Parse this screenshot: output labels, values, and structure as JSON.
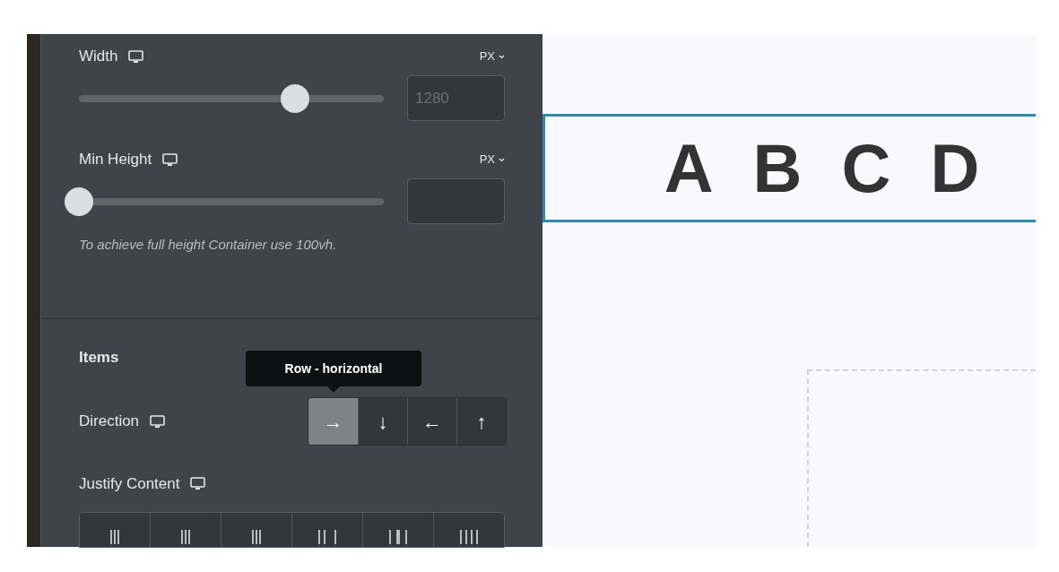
{
  "panel": {
    "sliders": [
      {
        "label": "Width",
        "unit": "PX",
        "level": 0.71,
        "placeholder": "1280"
      },
      {
        "label": "Min Height",
        "unit": "PX",
        "level": 0
      }
    ],
    "hint": "To achieve full height Container use 100vh.",
    "section_title": "Items",
    "direction": {
      "label": "Direction",
      "tooltip": "Row - horizontal",
      "options": [
        {
          "glyph": "→",
          "selected": true
        },
        {
          "glyph": "↓",
          "selected": false
        },
        {
          "glyph": "←",
          "selected": false
        },
        {
          "glyph": "↑",
          "selected": false
        }
      ]
    },
    "justify": {
      "label": "Justify Content"
    }
  },
  "canvas": {
    "letters": [
      "A",
      "B",
      "C",
      "D"
    ]
  }
}
